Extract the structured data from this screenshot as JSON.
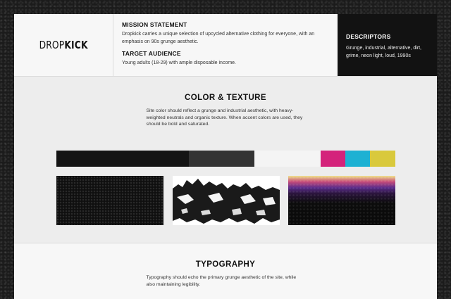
{
  "header": {
    "logo": {
      "part1": "DROP",
      "part2": "KICK"
    },
    "mission_label": "MISSION STATEMENT",
    "mission_text": "Dropkick carries a unique selection of upcycled alternative clothing for everyone, with an emphasis on 90s grunge aesthetic.",
    "audience_label": "TARGET AUDIENCE",
    "audience_text": "Young adults (18-29) with ample disposable income.",
    "descriptors_label": "DESCRIPTORS",
    "descriptors_text": "Grunge, industrial, alternative, dirt, grime, neon light, loud, 1990s"
  },
  "color_section": {
    "title": "COLOR & TEXTURE",
    "text": "Site color should reflect a grunge and industrial aesthetic, with heavy-weighted neutrals and organic texture. When accent colors are used, they should be bold and saturated.",
    "swatches": [
      {
        "color": "#141414",
        "weight": 0.39
      },
      {
        "color": "#333333",
        "weight": 0.195
      },
      {
        "color": "#f4f4f4",
        "weight": 0.195
      },
      {
        "color": "#d4237b",
        "weight": 0.073
      },
      {
        "color": "#1db1d3",
        "weight": 0.073
      },
      {
        "color": "#d9c93c",
        "weight": 0.074
      }
    ]
  },
  "typography_section": {
    "title": "TYPOGRAPHY",
    "text": "Typography should echo the primary grunge aesthetic of the site, while also maintaining legibility."
  }
}
